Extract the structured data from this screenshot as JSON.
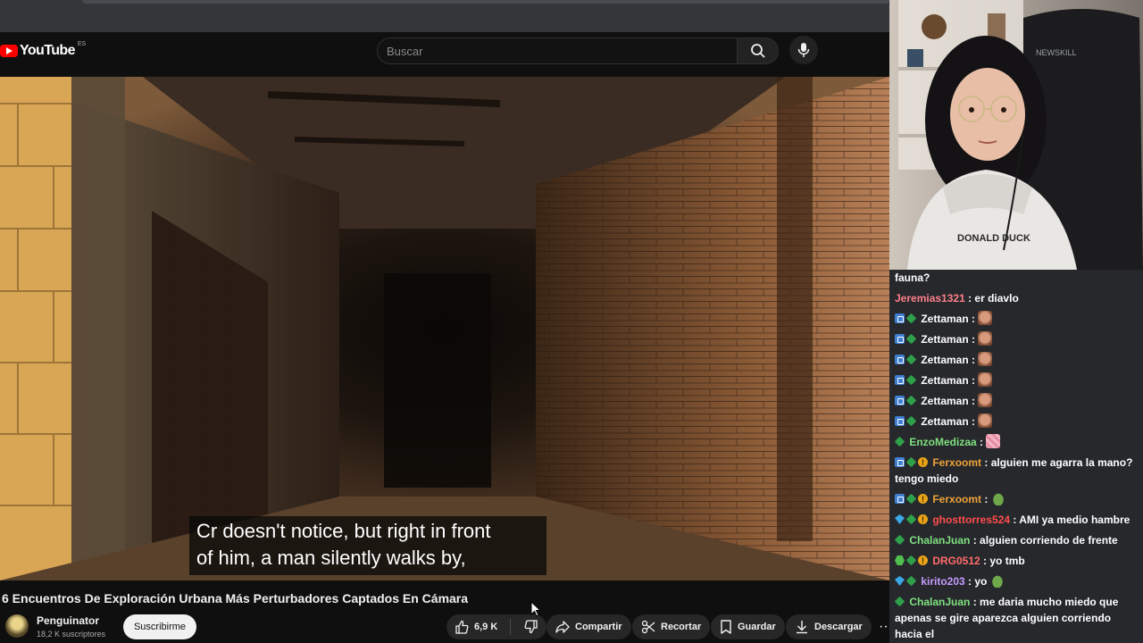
{
  "youtube": {
    "logo_word": "YouTube",
    "country_code": "ES",
    "search_placeholder": "Buscar",
    "subtitle_line1": "Cr doesn't notice, but right in front",
    "subtitle_line2": "of him, a man silently walks by,",
    "video_title": "6 Encuentros De Exploración Urbana Más Perturbadores Captados En Cámara",
    "channel_name": "Penguinator",
    "channel_subs": "18,2 K suscriptores",
    "subscribe_label": "Suscribirme",
    "like_count": "6,9 K",
    "share_label": "Compartir",
    "clip_label": "Recortar",
    "save_label": "Guardar",
    "download_label": "Descargar",
    "more_label": "···"
  },
  "colors": {
    "brand_red": "#ff0000",
    "chat_bg": "#26282c"
  },
  "chat": {
    "messages": [
      {
        "badges": [],
        "user": "",
        "user_color": "#ffffff",
        "text": "fauna?"
      },
      {
        "badges": [],
        "user": "Jeremias1321",
        "user_color": "#ff7f8a",
        "text": " : er diavlo"
      },
      {
        "badges": [
          "sq",
          "diamond"
        ],
        "user": "Zettaman",
        "user_color": "#ffffff",
        "text": " : ",
        "emote": "face"
      },
      {
        "badges": [
          "sq",
          "diamond"
        ],
        "user": "Zettaman",
        "user_color": "#ffffff",
        "text": " : ",
        "emote": "face"
      },
      {
        "badges": [
          "sq",
          "diamond"
        ],
        "user": "Zettaman",
        "user_color": "#ffffff",
        "text": " : ",
        "emote": "face"
      },
      {
        "badges": [
          "sq",
          "diamond"
        ],
        "user": "Zettaman",
        "user_color": "#ffffff",
        "text": " : ",
        "emote": "face"
      },
      {
        "badges": [
          "sq",
          "diamond"
        ],
        "user": "Zettaman",
        "user_color": "#ffffff",
        "text": " : ",
        "emote": "face"
      },
      {
        "badges": [
          "sq",
          "diamond"
        ],
        "user": "Zettaman",
        "user_color": "#ffffff",
        "text": " : ",
        "emote": "face"
      },
      {
        "badges": [
          "diamond"
        ],
        "user": "EnzoMedizaa",
        "user_color": "#7fe07f",
        "text": " : ",
        "emote": "pink"
      },
      {
        "badges": [
          "sq",
          "diamond",
          "gold"
        ],
        "user": "Ferxoomt",
        "user_color": "#f0a33a",
        "text": " : alguien me agarra la mano? tengo miedo"
      },
      {
        "badges": [
          "sq",
          "diamond",
          "gold"
        ],
        "user": "Ferxoomt",
        "user_color": "#f0a33a",
        "text": " : ",
        "emote": "frog"
      },
      {
        "badges": [
          "gem",
          "diamond",
          "gold"
        ],
        "user": "ghosttorres524",
        "user_color": "#ff4d4d",
        "text": " : AMI ya medio hambre"
      },
      {
        "badges": [
          "diamond"
        ],
        "user": "ChalanJuan",
        "user_color": "#7fe07f",
        "text": " : alguien corriendo de frente"
      },
      {
        "badges": [
          "hex",
          "diamond",
          "gold"
        ],
        "user": "DRG0512",
        "user_color": "#ff6b6b",
        "text": " : yo tmb"
      },
      {
        "badges": [
          "gem",
          "diamond"
        ],
        "user": "kirito203",
        "user_color": "#c59bff",
        "text": " : yo ",
        "emote": "frog"
      },
      {
        "badges": [
          "diamond"
        ],
        "user": "ChalanJuan",
        "user_color": "#7fe07f",
        "text": " : me daria mucho miedo que apenas se gire aparezca alguien corriendo hacia el"
      }
    ]
  },
  "webcam": {
    "chair_brand": "NEWSKILL",
    "hoodie_text": "DONALD DUCK"
  }
}
